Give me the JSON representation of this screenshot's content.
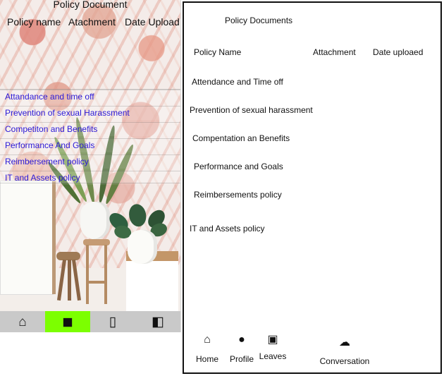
{
  "left_screen": {
    "title": "Policy Document",
    "headers": {
      "name": "Policy name",
      "attachment": "Atachment",
      "date": "Date Upload"
    },
    "items": [
      "Attandance and time off",
      "Prevention of sexual Harassment",
      "Competiton and Benefits",
      "Performance And Goals",
      "Reimbersement policy",
      "IT and Assets policy"
    ],
    "nav": {
      "home_icon": "home-icon",
      "profile_icon": "profile-icon",
      "leaves_icon": "clipboard-icon",
      "conversation_icon": "chat-icon",
      "active_color": "#7CFF00"
    }
  },
  "right_sketch": {
    "title": "Policy Documents",
    "headers": {
      "name": "Policy Name",
      "attachment": "Attachment",
      "date": "Date uploaed"
    },
    "items": [
      "Attendance and Time off",
      "Prevention of sexual harassment",
      "Compentation an Benefits",
      "Performance and Goals",
      "Reimbersements policy",
      "IT and Assets policy"
    ],
    "nav": {
      "home": "Home",
      "profile": "Profile",
      "leaves": "Leaves",
      "conversation": "Conversation"
    }
  }
}
